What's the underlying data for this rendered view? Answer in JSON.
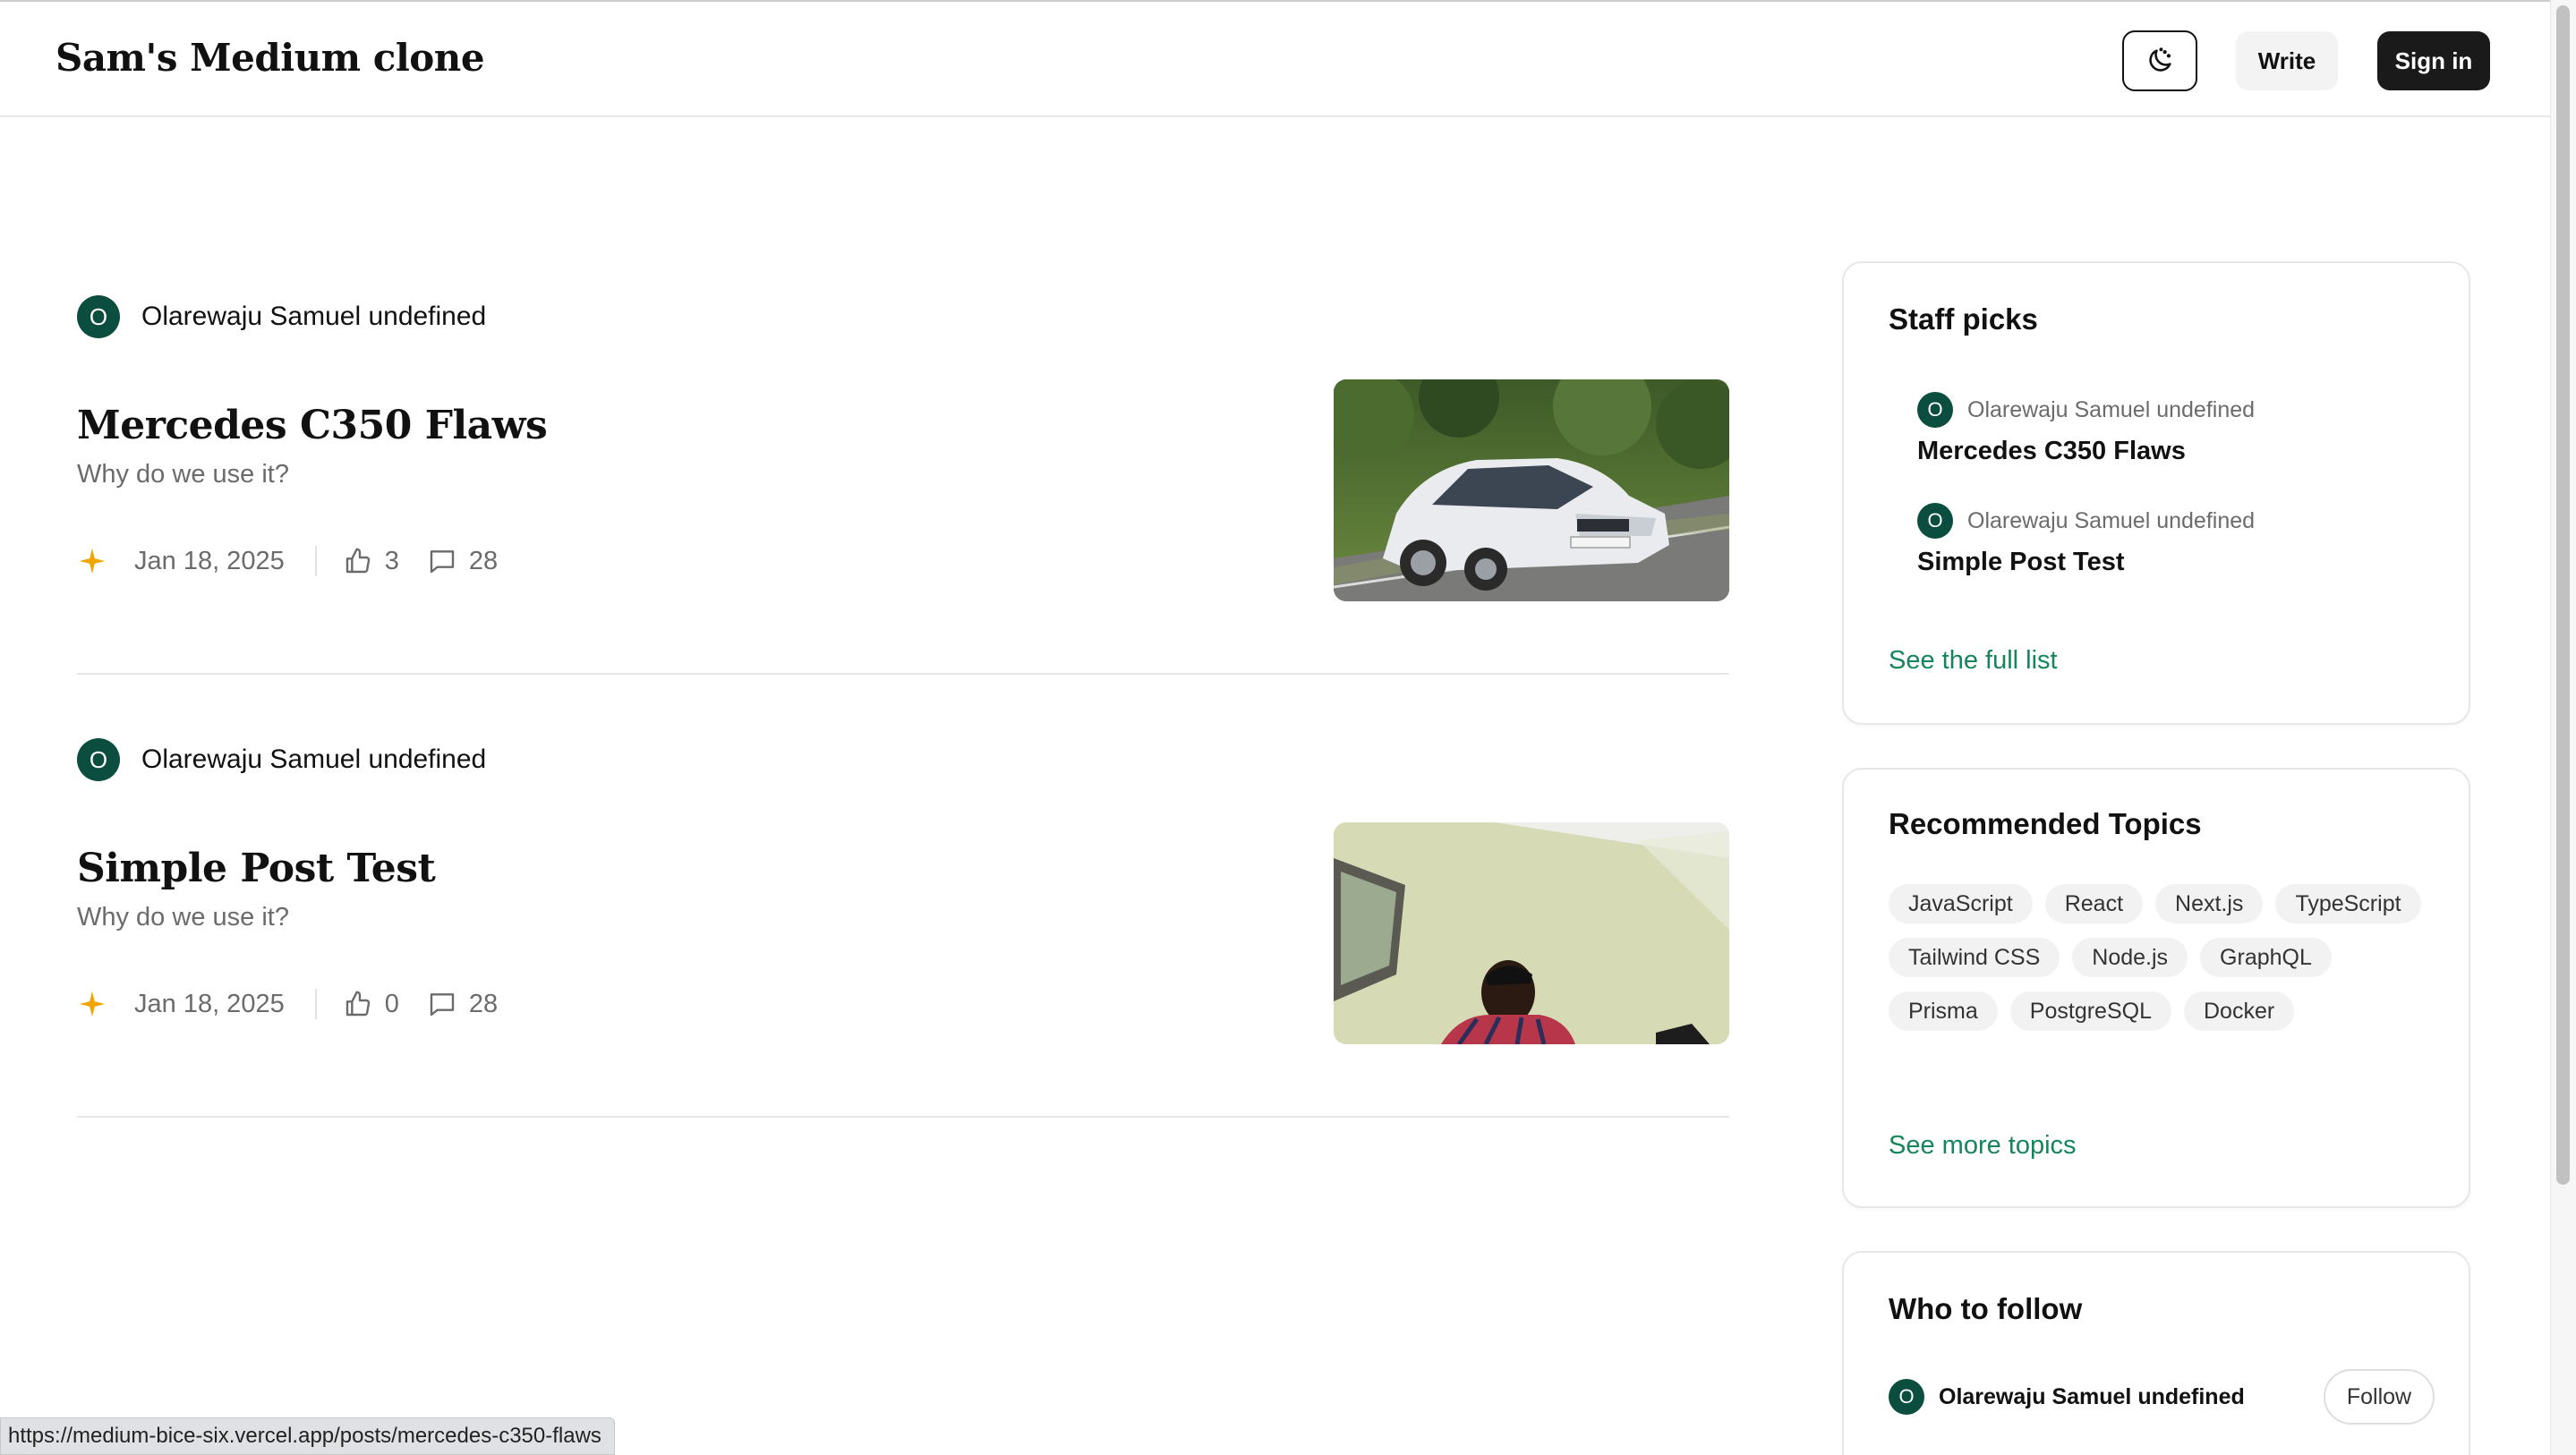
{
  "header": {
    "brand": "Sam's Medium clone",
    "write_label": "Write",
    "signin_label": "Sign in"
  },
  "posts": [
    {
      "author_initial": "O",
      "author": "Olarewaju Samuel undefined",
      "title": "Mercedes C350 Flaws",
      "subtitle": "Why do we use it?",
      "date": "Jan 18, 2025",
      "likes": "3",
      "comments": "28",
      "image_alt": "White sedan driving on a road"
    },
    {
      "author_initial": "O",
      "author": "Olarewaju Samuel undefined",
      "title": "Simple Post Test",
      "subtitle": "Why do we use it?",
      "date": "Jan 18, 2025",
      "likes": "0",
      "comments": "28",
      "image_alt": "Smiling person in a room"
    }
  ],
  "sidebar": {
    "staff_picks": {
      "title": "Staff picks",
      "items": [
        {
          "author_initial": "O",
          "author": "Olarewaju Samuel undefined",
          "title": "Mercedes C350 Flaws"
        },
        {
          "author_initial": "O",
          "author": "Olarewaju Samuel undefined",
          "title": "Simple Post Test"
        }
      ],
      "link": "See the full list"
    },
    "topics": {
      "title": "Recommended Topics",
      "items": [
        "JavaScript",
        "React",
        "Next.js",
        "TypeScript",
        "Tailwind CSS",
        "Node.js",
        "GraphQL",
        "Prisma",
        "PostgreSQL",
        "Docker"
      ],
      "link": "See more topics"
    },
    "who_to_follow": {
      "title": "Who to follow",
      "author_initial": "O",
      "name": "Olarewaju Samuel undefined",
      "follow_label": "Follow"
    }
  },
  "status_bar": {
    "url": "https://medium-bice-six.vercel.app/posts/mercedes-c350-flaws"
  },
  "colors": {
    "avatar": "#0b4d3e",
    "accent_green": "#15855a",
    "star": "#f0a500"
  }
}
